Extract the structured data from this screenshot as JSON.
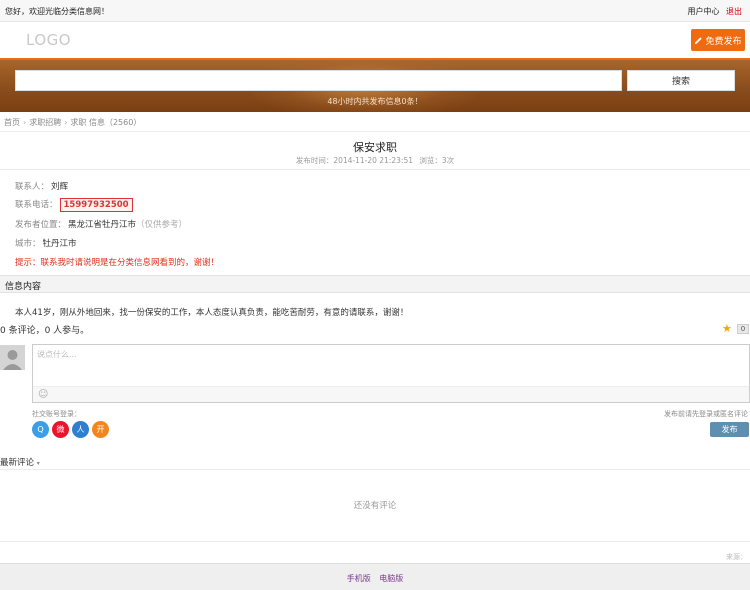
{
  "topbar": {
    "welcome": "您好，欢迎光临分类信息网！",
    "user_center": "用户中心",
    "logout": "退出"
  },
  "header": {
    "logo": "LOGO",
    "post_button": "免费发布"
  },
  "search": {
    "placeholder": "",
    "button": "搜索",
    "stat": "48小时内共发布信息0条！"
  },
  "breadcrumb": [
    "首页",
    "求职招聘",
    "求职 信息（2560）"
  ],
  "post": {
    "title": "保安求职",
    "published_label": "发布时间：2014-11-20 21:23:51",
    "views_label": "浏览：3次",
    "contact_label": "联系人：",
    "contact_value": "刘辉",
    "phone_label": "联系电话：",
    "phone_value": "15997932500",
    "location_label": "发布者位置：",
    "location_value": "黑龙江省牡丹江市",
    "location_hint": "（仅供参考）",
    "city_label": "城市：",
    "city_value": "牡丹江市",
    "warning": "提示：联系我时请说明是在分类信息网看到的，谢谢！"
  },
  "section": {
    "info_title": "信息内容"
  },
  "content": "本人41岁，刚从外地回来，找一份保安的工作，本人态度认真负责，能吃苦耐劳，有意的请联系，谢谢！",
  "comments": {
    "count_text": "0 条评论，0 人参与。",
    "star_count": "0",
    "placeholder": "说点什么...",
    "social_label": "社交账号登录：",
    "social_note": "发布前请先登录或匿名评论",
    "publish_button": "发布",
    "latest_label": "最新评论",
    "empty_text": "还没有评论",
    "source": "来源："
  },
  "social_icons": [
    {
      "name": "qq-icon",
      "glyph": "Q",
      "color": "#3c9ee6"
    },
    {
      "name": "weibo-icon",
      "glyph": "微",
      "color": "#e6162d"
    },
    {
      "name": "renren-icon",
      "glyph": "人",
      "color": "#2f7fcf"
    },
    {
      "name": "kaixin-icon",
      "glyph": "开",
      "color": "#f2861e"
    }
  ],
  "footer": {
    "mobile": "手机版",
    "pc": "电脑版"
  },
  "colors": {
    "accent": "#f06a10",
    "banner": "#8a4d1c",
    "warning": "#e0301e",
    "publish": "#5e8fb0"
  }
}
